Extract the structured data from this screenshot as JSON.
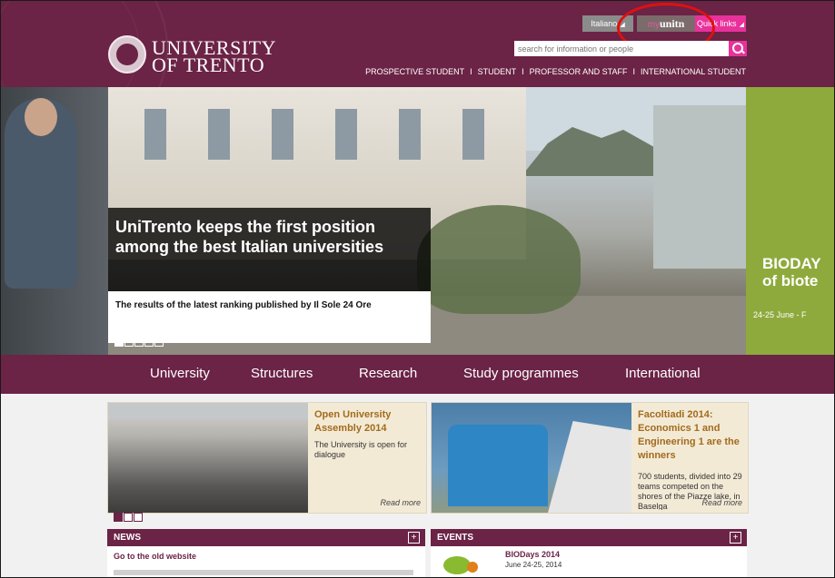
{
  "header": {
    "logo_line1": "UNIVERSITY",
    "logo_line2": "OF TRENTO",
    "language_tab": "Italiano",
    "myunitn_my": "my",
    "myunitn_unitn": "unitn",
    "quicklinks_tab": "Quick links",
    "search_placeholder": "search for information or people",
    "audience_links": [
      "PROSPECTIVE STUDENT",
      "STUDENT",
      "PROFESSOR AND STAFF",
      "INTERNATIONAL STUDENT"
    ]
  },
  "hero": {
    "headline": "UniTrento keeps the first position among the best Italian universities",
    "subtitle": "The results of the latest ranking published by Il Sole 24 Ore",
    "side_title_1": "BIODAY",
    "side_title_2": "of biote",
    "side_date": "24-25 June - F",
    "slides_total": 5,
    "active_slide": 1
  },
  "main_nav": [
    "University",
    "Structures",
    "Research",
    "Study programmes",
    "International"
  ],
  "featured": [
    {
      "title": "Open University Assembly 2014",
      "text": "The University is open for dialogue",
      "more": "Read more"
    },
    {
      "title": "Facoltiadi 2014: Economics 1 and Engineering 1 are the winners",
      "text": "700 students, divided into 29 teams competed on the shores of the Piazze lake, in Baselga",
      "more": "Read more"
    }
  ],
  "featured_pages": {
    "total": 3,
    "active": 1
  },
  "news": {
    "heading": "NEWS",
    "first_item": "Go to the old website"
  },
  "events": {
    "heading": "EVENTS",
    "first_item_title": "BIODays 2014",
    "first_item_date": "June 24-25, 2014"
  },
  "colors": {
    "brand": "#6b2346",
    "accent": "#e8319b",
    "highlight_circle": "#e01010",
    "card_title": "#a26b1c"
  }
}
